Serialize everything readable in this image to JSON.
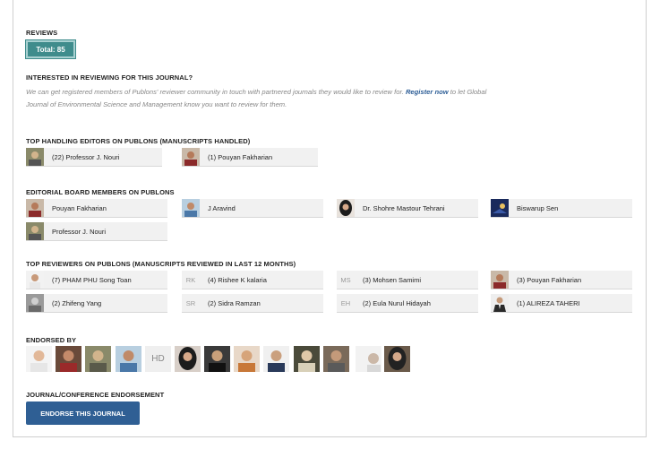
{
  "reviews": {
    "title": "REVIEWS",
    "total_label": "Total: 85"
  },
  "interest": {
    "title": "INTERESTED IN REVIEWING FOR THIS JOURNAL?",
    "text_before": "We can get registered members of Publons' reviewer community in touch with partnered journals they would like to review for. ",
    "link": "Register now",
    "text_after": " to let Global Journal of Environmental Science and Management know you want to review for them."
  },
  "handling_editors": {
    "title": "TOP HANDLING EDITORS ON PUBLONS (MANUSCRIPTS HANDLED)",
    "items": [
      {
        "label": "(22) Professor J. Nouri",
        "avatar": "photo-olive"
      },
      {
        "label": "(1) Pouyan Fakharian",
        "avatar": "photo-red"
      }
    ]
  },
  "board": {
    "title": "EDITORIAL BOARD MEMBERS ON PUBLONS",
    "items": [
      {
        "label": "Pouyan Fakharian",
        "avatar": "photo-red"
      },
      {
        "label": "J Aravind",
        "avatar": "photo-blue"
      },
      {
        "label": "Dr. Shohre Mastour Tehrani",
        "avatar": "photo-dark"
      },
      {
        "label": "Biswarup Sen",
        "avatar": "photo-navy"
      },
      {
        "label": "Professor J. Nouri",
        "avatar": "photo-olive"
      }
    ]
  },
  "reviewers": {
    "title": "TOP REVIEWERS ON PUBLONS (MANUSCRIPTS REVIEWED IN LAST 12 MONTHS)",
    "items": [
      {
        "label": "(7) PHAM PHU Song Toan",
        "avatar": "photo-white"
      },
      {
        "label": "(4) Rishee K kalaria",
        "initials": "RK"
      },
      {
        "label": "(3) Mohsen Samimi",
        "initials": "MS"
      },
      {
        "label": "(3) Pouyan Fakharian",
        "avatar": "photo-red"
      },
      {
        "label": "(2) Zhifeng Yang",
        "avatar": "photo-grey"
      },
      {
        "label": "(2) Sidra Ramzan",
        "initials": "SR"
      },
      {
        "label": "(2) Eula Nurul Hidayah",
        "initials": "EH"
      },
      {
        "label": "(1) ALIREZA TAHERI",
        "avatar": "photo-suit"
      }
    ]
  },
  "endorsed": {
    "title": "ENDORSED BY",
    "hd_initials": "HD"
  },
  "journal_endorsement": {
    "title": "JOURNAL/CONFERENCE ENDORSEMENT",
    "button_label": "ENDORSE THIS JOURNAL"
  },
  "colors": {
    "badge": "#3f8c8c",
    "button": "#2f5f94",
    "link": "#2c5d96",
    "chip_bg": "#f1f1f1"
  }
}
